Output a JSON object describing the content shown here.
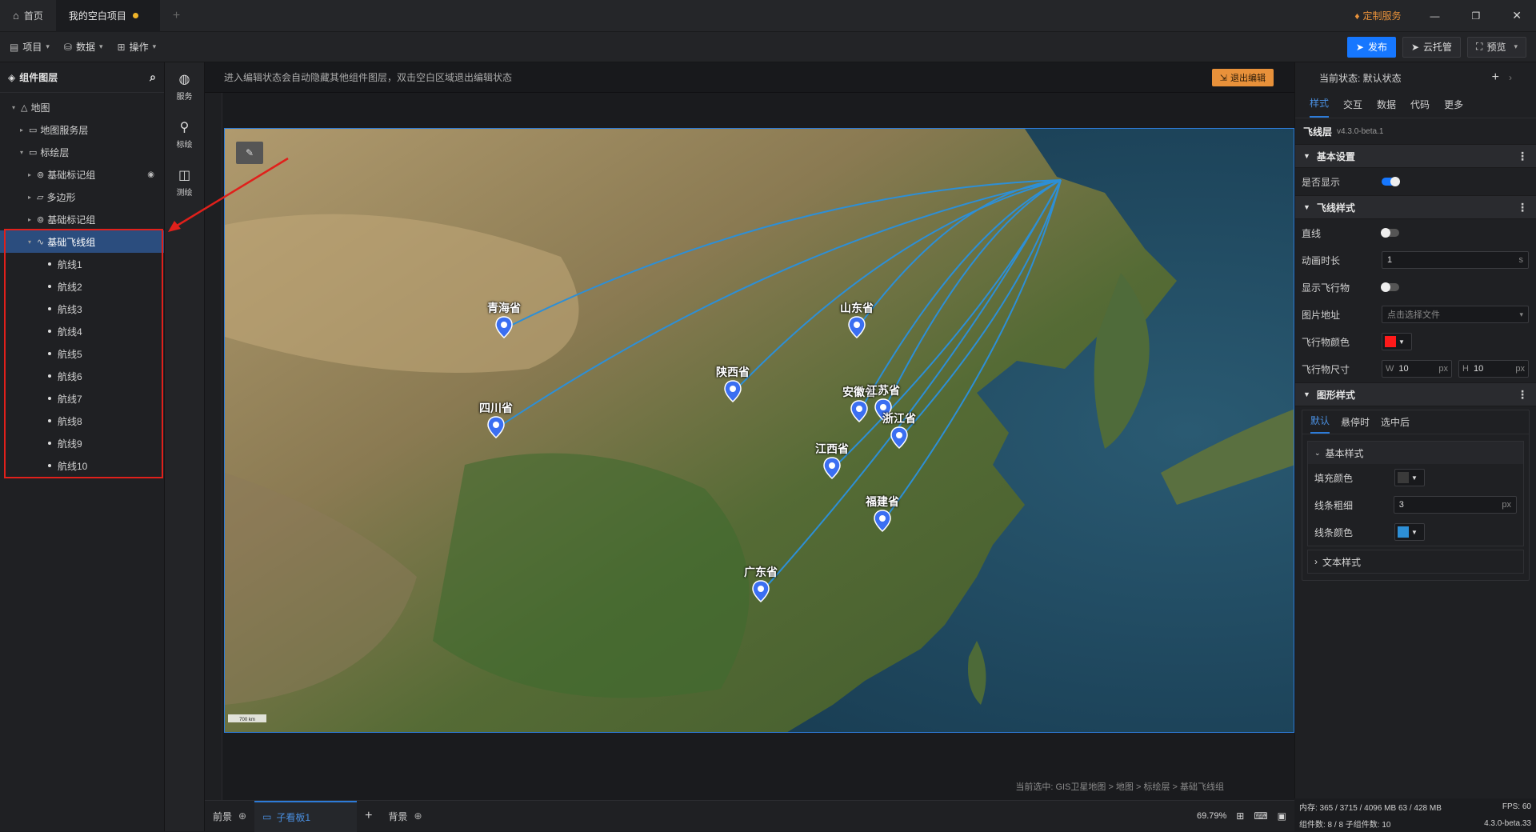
{
  "titlebar": {
    "home_tab": "首页",
    "project_tab": "我的空白项目",
    "custom_service": "定制服务"
  },
  "menubar": {
    "items": [
      {
        "label": "项目",
        "icon": "file-icon"
      },
      {
        "label": "数据",
        "icon": "database-icon"
      },
      {
        "label": "操作",
        "icon": "grid-icon"
      }
    ],
    "publish": "发布",
    "cloud": "云托管",
    "preview": "预览"
  },
  "layers": {
    "title": "组件图层",
    "items": [
      {
        "label": "地图",
        "level": 0,
        "arrow": "▾"
      },
      {
        "label": "地图服务层",
        "level": 1,
        "arrow": "▸"
      },
      {
        "label": "标绘层",
        "level": 1,
        "arrow": "▾"
      },
      {
        "label": "基础标记组",
        "level": 2,
        "arrow": "▸"
      },
      {
        "label": "多边形",
        "level": 2,
        "arrow": "▸"
      },
      {
        "label": "基础标记组",
        "level": 2,
        "arrow": "▸"
      },
      {
        "label": "基础飞线组",
        "level": 2,
        "arrow": "▾"
      }
    ],
    "routes": [
      "航线1",
      "航线2",
      "航线3",
      "航线4",
      "航线5",
      "航线6",
      "航线7",
      "航线8",
      "航线9",
      "航线10"
    ]
  },
  "tools": [
    {
      "label": "服务",
      "icon": "globe-icon"
    },
    {
      "label": "标绘",
      "icon": "pin-icon"
    },
    {
      "label": "测绘",
      "icon": "measure-icon"
    }
  ],
  "notice": {
    "text": "进入编辑状态会自动隐藏其他组件图层，双击空白区域退出编辑状态",
    "exit": "退出编辑"
  },
  "map": {
    "scale": "700 km",
    "provinces": [
      "青海省",
      "山东省",
      "陕西省",
      "安徽省",
      "江苏省",
      "四川省",
      "浙江省",
      "江西省",
      "福建省",
      "广东省"
    ]
  },
  "breadcrumb": "当前选中: GIS卫星地图 > 地图 > 标绘层 > 基础飞线组",
  "bottom": {
    "front": "前景",
    "subpanel": "子看板1",
    "background": "背景",
    "zoom": "69.79%"
  },
  "right": {
    "state_label": "当前状态: 默认状态",
    "tabs": [
      "样式",
      "交互",
      "数据",
      "代码",
      "更多"
    ],
    "component_name": "飞线层",
    "version": "v4.3.0-beta.1",
    "basic_settings": "基本设置",
    "show_label": "是否显示",
    "flyline_style": "飞线样式",
    "straight": "直线",
    "anim_duration": "动画时长",
    "anim_value": "1",
    "anim_unit": "s",
    "show_flyer": "显示飞行物",
    "image_url": "图片地址",
    "image_placeholder": "点击选择文件",
    "flyer_color": "飞行物颜色",
    "flyer_size": "飞行物尺寸",
    "w_label": "W",
    "w_value": "10",
    "h_label": "H",
    "h_value": "10",
    "px": "px",
    "shape_style": "图形样式",
    "state_tabs": [
      "默认",
      "悬停时",
      "选中后"
    ],
    "base_style": "基本样式",
    "fill_color": "填充颜色",
    "line_width": "线条粗细",
    "line_width_value": "3",
    "line_color": "线条颜色",
    "text_style": "文本样式"
  },
  "colors": {
    "flyer": "#ff1a1a",
    "fill": "#3a3a3a",
    "line": "#2d8fd6",
    "accent": "#1677ff"
  },
  "status": {
    "memory": "内存: 365 / 3715 / 4096 MB  63 / 428 MB",
    "fps": "FPS: 60",
    "counts": "组件数: 8 / 8  子组件数: 10",
    "version": "4.3.0-beta.33"
  }
}
